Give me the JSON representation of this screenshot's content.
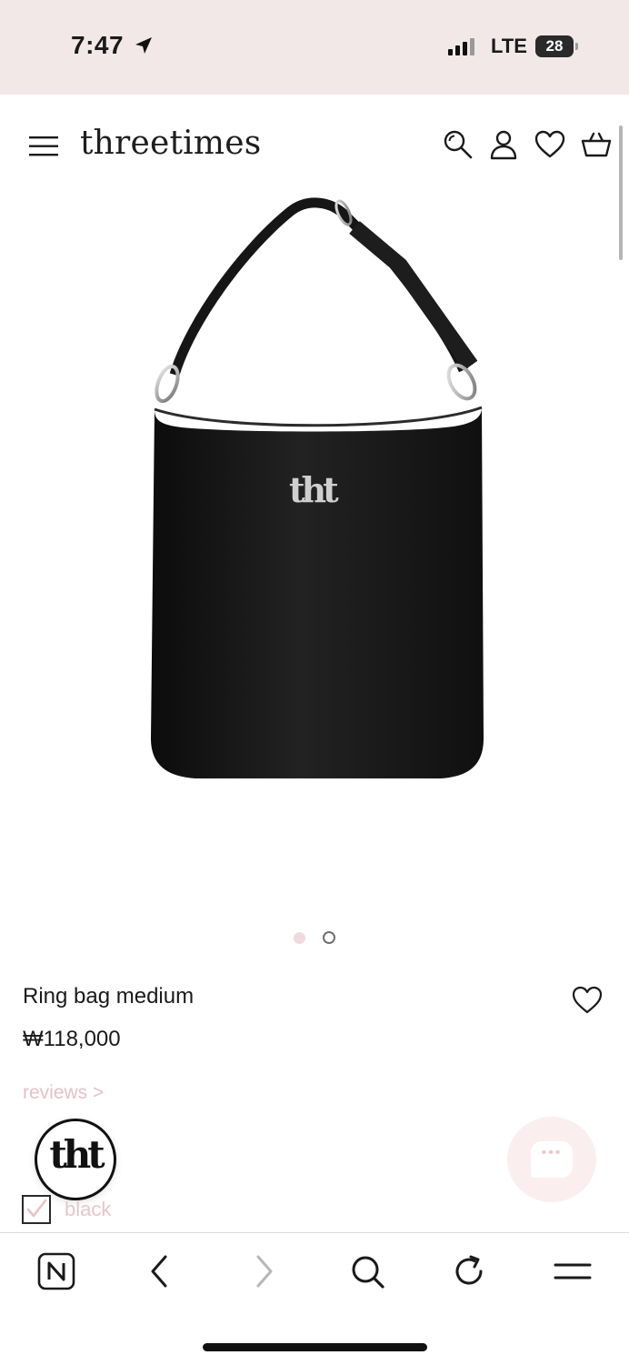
{
  "status_bar": {
    "time": "7:47",
    "location_icon": "location-arrow-icon",
    "signal_icon": "cellular-signal-icon",
    "network": "LTE",
    "battery": "28",
    "background": "#f3e8e8"
  },
  "header": {
    "brand": "threetimes",
    "icons": [
      "menu-icon",
      "search-icon",
      "account-icon",
      "wishlist-heart-icon",
      "cart-basket-icon"
    ]
  },
  "product": {
    "image_icon": "black-shoulder-bag-image",
    "name": "Ring bag medium",
    "price": "₩118,000",
    "reviews_link": "reviews >",
    "carousel": {
      "total": 2,
      "active": 1
    }
  },
  "floating": {
    "logo_text": "tht",
    "chat_icon": "chat-bubble-icon",
    "chat_dots": "•••"
  },
  "option": {
    "color_label": "black",
    "checked": true
  },
  "browser_toolbar": {
    "icons": [
      "naver-n-icon",
      "back-arrow-icon",
      "forward-arrow-icon",
      "search-icon",
      "refresh-icon",
      "menu-icon"
    ]
  },
  "colors": {
    "accent_pink": "#e3c2c6",
    "text": "#1a1a1a"
  }
}
